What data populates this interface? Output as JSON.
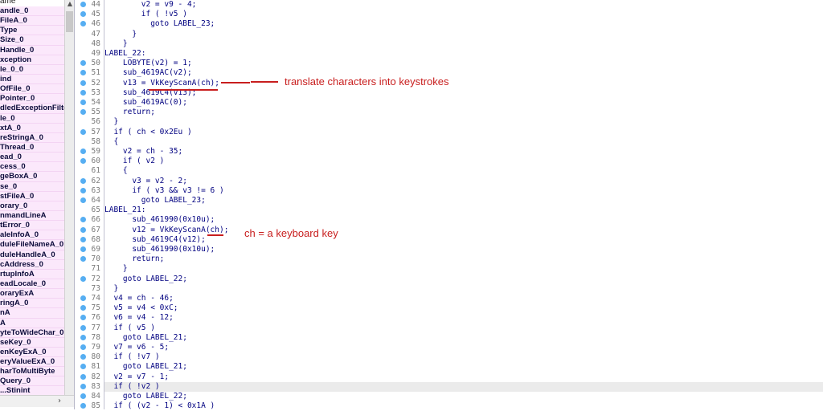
{
  "sidebar": {
    "header": "ame",
    "scroll_right_arrow": "›",
    "scroll_up_arrow": "▲",
    "functions": [
      "andle_0",
      "FileA_0",
      "Type",
      "Size_0",
      "Handle_0",
      "xception",
      "le_0_0",
      "ind",
      "OfFile_0",
      "Pointer_0",
      "dledExceptionFilte",
      "le_0",
      "xtA_0",
      "reStringA_0",
      "Thread_0",
      "ead_0",
      "cess_0",
      "geBoxA_0",
      "se_0",
      "stFileA_0",
      "orary_0",
      "nmandLineA",
      "tError_0",
      "aleInfoA_0",
      "duleFileNameA_0",
      "duleHandleA_0",
      "cAddress_0",
      "rtupInfoA",
      "eadLocale_0",
      "oraryExA",
      "ringA_0",
      "nA",
      "A",
      "yteToWideChar_0",
      "seKey_0",
      "enKeyExA_0",
      "eryValueExA_0",
      "harToMultiByte",
      "Query_0",
      "...Stinint"
    ]
  },
  "code": {
    "lines": [
      {
        "no": "44",
        "dot": true,
        "text": "        v2 = v9 - 4;"
      },
      {
        "no": "45",
        "dot": true,
        "text": "        if ( !v5 )"
      },
      {
        "no": "46",
        "dot": true,
        "text": "          goto LABEL_23;"
      },
      {
        "no": "47",
        "dot": false,
        "text": "      }"
      },
      {
        "no": "48",
        "dot": false,
        "text": "    }"
      },
      {
        "no": "49",
        "dot": false,
        "text": "LABEL_22:"
      },
      {
        "no": "50",
        "dot": true,
        "text": "    LOBYTE(v2) = 1;"
      },
      {
        "no": "51",
        "dot": true,
        "text": "    sub_4619AC(v2);"
      },
      {
        "no": "52",
        "dot": true,
        "text": "    v13 = VkKeyScanA(ch);"
      },
      {
        "no": "53",
        "dot": true,
        "text": "    sub_4619C4(v13);"
      },
      {
        "no": "54",
        "dot": true,
        "text": "    sub_4619AC(0);"
      },
      {
        "no": "55",
        "dot": true,
        "text": "    return;"
      },
      {
        "no": "56",
        "dot": false,
        "text": "  }"
      },
      {
        "no": "57",
        "dot": true,
        "text": "  if ( ch < 0x2Eu )"
      },
      {
        "no": "58",
        "dot": false,
        "text": "  {"
      },
      {
        "no": "59",
        "dot": true,
        "text": "    v2 = ch - 35;"
      },
      {
        "no": "60",
        "dot": true,
        "text": "    if ( v2 )"
      },
      {
        "no": "61",
        "dot": false,
        "text": "    {"
      },
      {
        "no": "62",
        "dot": true,
        "text": "      v3 = v2 - 2;"
      },
      {
        "no": "63",
        "dot": true,
        "text": "      if ( v3 && v3 != 6 )"
      },
      {
        "no": "64",
        "dot": true,
        "text": "        goto LABEL_23;"
      },
      {
        "no": "65",
        "dot": false,
        "text": "LABEL_21:"
      },
      {
        "no": "66",
        "dot": true,
        "text": "      sub_461990(0x10u);"
      },
      {
        "no": "67",
        "dot": true,
        "text": "      v12 = VkKeyScanA(ch);"
      },
      {
        "no": "68",
        "dot": true,
        "text": "      sub_4619C4(v12);"
      },
      {
        "no": "69",
        "dot": true,
        "text": "      sub_461990(0x10u);"
      },
      {
        "no": "70",
        "dot": true,
        "text": "      return;"
      },
      {
        "no": "71",
        "dot": false,
        "text": "    }"
      },
      {
        "no": "72",
        "dot": true,
        "text": "    goto LABEL_22;"
      },
      {
        "no": "73",
        "dot": false,
        "text": "  }"
      },
      {
        "no": "74",
        "dot": true,
        "text": "  v4 = ch - 46;"
      },
      {
        "no": "75",
        "dot": true,
        "text": "  v5 = v4 < 0xC;"
      },
      {
        "no": "76",
        "dot": true,
        "text": "  v6 = v4 - 12;"
      },
      {
        "no": "77",
        "dot": true,
        "text": "  if ( v5 )"
      },
      {
        "no": "78",
        "dot": true,
        "text": "    goto LABEL_21;"
      },
      {
        "no": "79",
        "dot": true,
        "text": "  v7 = v6 - 5;"
      },
      {
        "no": "80",
        "dot": true,
        "text": "  if ( !v7 )"
      },
      {
        "no": "81",
        "dot": true,
        "text": "    goto LABEL_21;"
      },
      {
        "no": "82",
        "dot": true,
        "text": "  v2 = v7 - 1;"
      },
      {
        "no": "83",
        "dot": true,
        "text": "  if ( !v2 )"
      },
      {
        "no": "84",
        "dot": true,
        "text": "    goto LABEL_22;"
      },
      {
        "no": "85",
        "dot": true,
        "text": "  if ( (v2 - 1) < 0x1A )"
      }
    ],
    "highlighted_line": "83"
  },
  "annotations": {
    "keystrokes_note": "translate characters into keystrokes",
    "ch_note": "ch = a keyboard key",
    "color": "#c81e1e"
  }
}
